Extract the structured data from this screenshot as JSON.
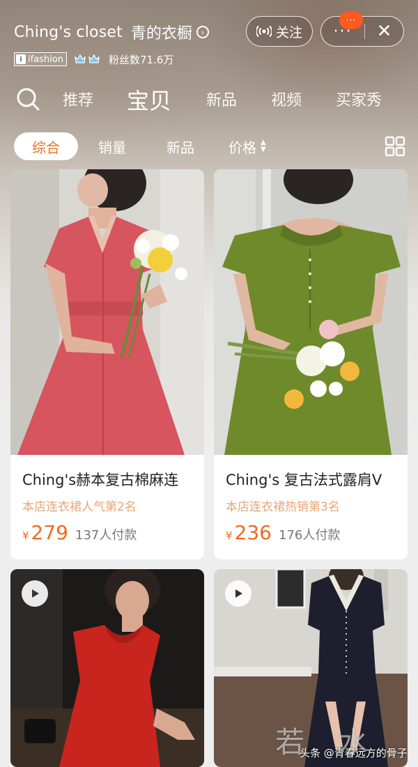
{
  "header": {
    "shop_name": "Ching's closet",
    "shop_name_cn": "青的衣橱",
    "follow_label": "关注",
    "more_label": "···",
    "notification_label": "···",
    "close_label": "✕",
    "badge_brand": "ifashion",
    "fans_text": "粉丝数71.6万"
  },
  "tabs": [
    {
      "label": "推荐"
    },
    {
      "label": "宝贝"
    },
    {
      "label": "新品"
    },
    {
      "label": "视频"
    },
    {
      "label": "买家秀"
    }
  ],
  "active_tab": "宝贝",
  "filters": [
    {
      "label": "综合"
    },
    {
      "label": "销量"
    },
    {
      "label": "新品"
    },
    {
      "label": "价格"
    }
  ],
  "active_filter": "综合",
  "products": [
    {
      "title": "Ching's赫本复古棉麻连",
      "rank": "本店连衣裙人气第2名",
      "currency": "¥",
      "price": "279",
      "sold": "137人付款",
      "dress_color": "#d7555f",
      "has_video": false
    },
    {
      "title": "Ching's 复古法式露肩V",
      "rank": "本店连衣裙热销第3名",
      "currency": "¥",
      "price": "236",
      "sold": "176人付款",
      "dress_color": "#6f8a2a",
      "has_video": false
    },
    {
      "dress_color": "#c8251f",
      "has_video": true
    },
    {
      "dress_color": "#1e1f2e",
      "has_video": true
    }
  ],
  "colors": {
    "accent": "#f0711e",
    "price": "#f06a1e",
    "rank_text": "#e8a574",
    "notification": "#ff5a1f"
  },
  "watermark": {
    "text": "若 水 网",
    "credit": "头条 @青春远方的骨子"
  }
}
